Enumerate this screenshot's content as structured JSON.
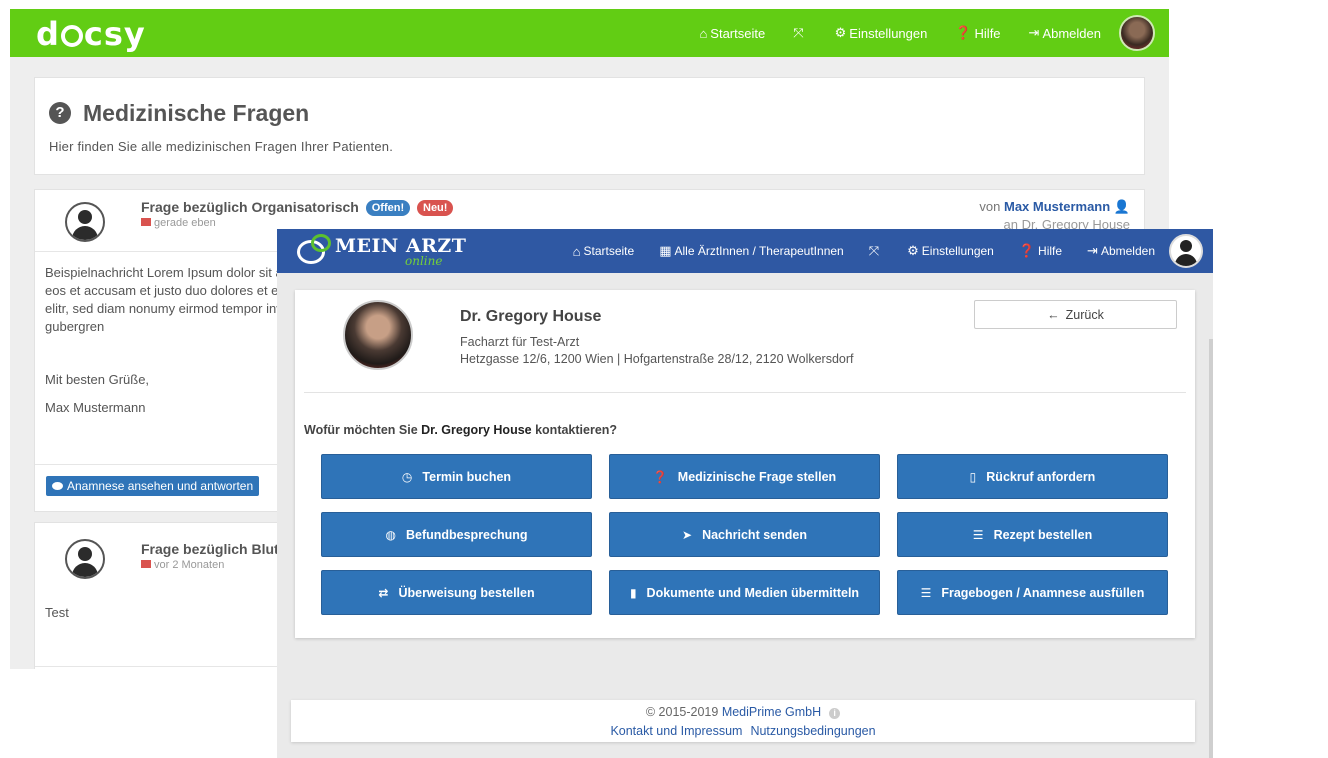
{
  "back": {
    "logo": "docsy",
    "nav": {
      "home": "Startseite",
      "fullscreen_icon": "expand-icon",
      "settings": "Einstellungen",
      "help": "Hilfe",
      "logout": "Abmelden"
    },
    "page_title": "Medizinische Fragen",
    "page_subtitle": "Hier finden Sie alle medizinischen Fragen Ihrer Patienten.",
    "question1": {
      "title": "Frage bezüglich Organisatorisch",
      "badge_open": "Offen!",
      "badge_new": "Neu!",
      "time": "gerade eben",
      "from_prefix": "von",
      "from_name": "Max Mustermann",
      "to": "an Dr. Gregory House",
      "body": "Beispielnachricht Lorem Ipsum dolor sit amet, consetetur sadipscing elitr, sed diam nonumy eirmod tempor invidunt ut labore et dolore magna aliquyam erat, sed diam voluptua. At vero eos et accusam et justo duo dolores et ea rebum. Stet clita kasd gubergren, no sea takimata sanctus est Lorem ipsum dolor sit amet. Lorem ipsum dolor sit amet, consetetur sadipscing elitr, sed diam nonumy eirmod tempor invidunt ut labore et dolore magna aliquyam erat, sed diam voluptua. At vero eos et accusam et justo duo dolores et ea rebum. Stet clita kasd gubergren",
      "greeting": "Mit besten Grüße,",
      "signature": "Max Mustermann",
      "action_label": "Anamnese ansehen und antworten"
    },
    "question2": {
      "title": "Frage bezüglich Blutbild",
      "time": "vor 2 Monaten",
      "body": "Test"
    }
  },
  "front": {
    "logo_main": "MEIN ARZT",
    "logo_sub": "online",
    "nav": {
      "home": "Startseite",
      "all_doctors": "Alle ÄrztInnen / TherapeutInnen",
      "fullscreen_icon": "expand-icon",
      "settings": "Einstellungen",
      "help": "Hilfe",
      "logout": "Abmelden"
    },
    "doctor": {
      "name": "Dr. Gregory House",
      "specialty": "Facharzt für Test-Arzt",
      "address": "Hetzgasse 12/6, 1200 Wien | Hofgartenstraße 28/12, 2120 Wolkersdorf"
    },
    "back_button": "Zurück",
    "prompt_pre": "Wofür möchten Sie",
    "prompt_name": "Dr. Gregory House",
    "prompt_post": "kontaktieren?",
    "actions": [
      {
        "label": "Termin buchen",
        "icon": "clock-icon"
      },
      {
        "label": "Medizinische Frage stellen",
        "icon": "question-icon"
      },
      {
        "label": "Rückruf anfordern",
        "icon": "mobile-phone-icon"
      },
      {
        "label": "Befundbesprechung",
        "icon": "globe-icon"
      },
      {
        "label": "Nachricht senden",
        "icon": "paper-plane-icon"
      },
      {
        "label": "Rezept bestellen",
        "icon": "list-icon"
      },
      {
        "label": "Überweisung bestellen",
        "icon": "exchange-icon"
      },
      {
        "label": "Dokumente und Medien übermitteln",
        "icon": "file-icon"
      },
      {
        "label": "Fragebogen / Anamnese ausfüllen",
        "icon": "list-icon"
      }
    ],
    "footer": {
      "copyright": "© 2015-2019",
      "company": "MediPrime GmbH",
      "link1": "Kontakt und Impressum",
      "link2": "Nutzungsbedingungen"
    }
  },
  "colors": {
    "docsy_green": "#62cd14",
    "meinarzt_blue": "#2f58a3",
    "action_blue": "#2f74b8",
    "badge_red": "#d9534f"
  }
}
